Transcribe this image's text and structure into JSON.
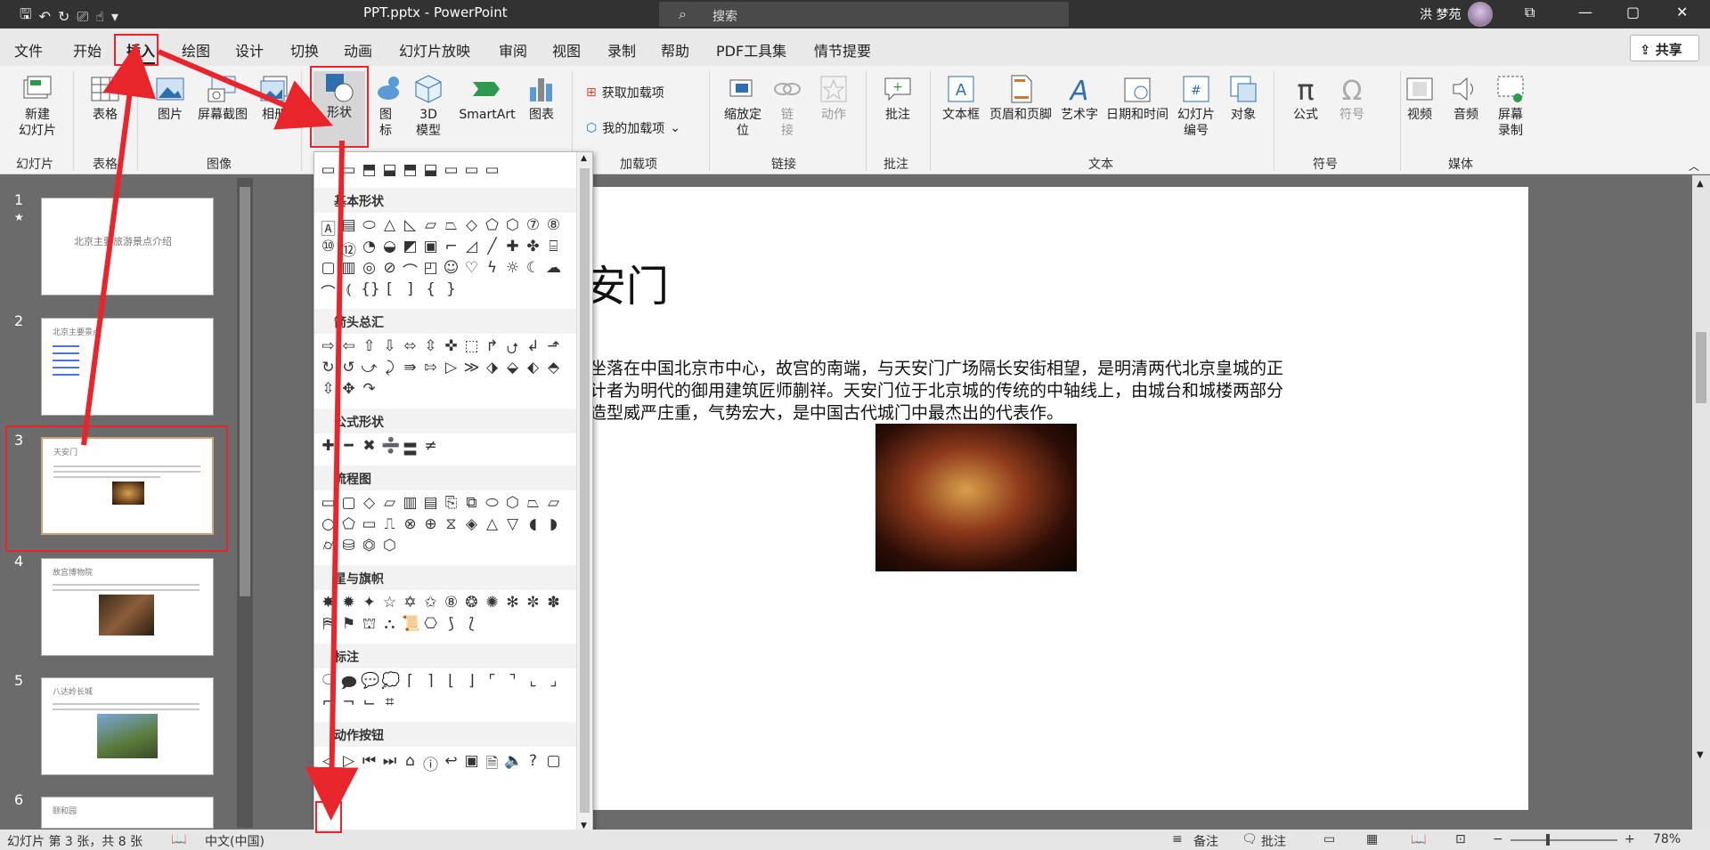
{
  "window": {
    "title": "PPT.pptx - PowerPoint",
    "search_placeholder": "搜索",
    "user_name": "洪 梦苑"
  },
  "menu": {
    "tabs": [
      "文件",
      "开始",
      "插入",
      "绘图",
      "设计",
      "切换",
      "动画",
      "幻灯片放映",
      "审阅",
      "视图",
      "录制",
      "帮助",
      "PDF工具集",
      "情节提要"
    ],
    "active": "插入",
    "share_label": "共享"
  },
  "ribbon": {
    "new_slide": "新建\n幻灯片",
    "table": "表格",
    "picture": "图片",
    "screenshot": "屏幕截图",
    "album": "相册",
    "shapes": "形状",
    "icons": "图\n标",
    "model3d": "3D\n模型",
    "smartart": "SmartArt",
    "chart": "图表",
    "get_addins": "获取加载项",
    "my_addins": "我的加载项",
    "zoom": "缩放定\n位",
    "link": "链\n接",
    "action": "动作",
    "comment": "批注",
    "textbox": "文本框",
    "header_footer": "页眉和页脚",
    "wordart": "艺术字",
    "datetime": "日期和时间",
    "slide_number": "幻灯片\n编号",
    "object": "对象",
    "equation": "公式",
    "symbol": "符号",
    "video": "视频",
    "audio": "音频",
    "screen_record": "屏幕\n录制",
    "groups": {
      "slides": "幻灯片",
      "tables": "表格",
      "images": "图像",
      "addins": "加载项",
      "links": "链接",
      "comments": "批注",
      "text": "文本",
      "symbols": "符号",
      "media": "媒体"
    }
  },
  "thumbnails": [
    {
      "num": "1",
      "star": "★",
      "title": "北京主要旅游景点介绍"
    },
    {
      "num": "2",
      "title": "北京主要景点"
    },
    {
      "num": "3",
      "title": "天安门"
    },
    {
      "num": "4",
      "title": "故宫博物院"
    },
    {
      "num": "5",
      "title": "八达岭长城"
    },
    {
      "num": "6",
      "title": "颐和园"
    }
  ],
  "slide": {
    "title": "安门",
    "body_line1": "坐落在中国北京市中心，故宫的南端，与天安门广场隔长安街相望，是明清两代北京皇城的正",
    "body_line2": "计者为明代的御用建筑匠师蒯祥。天安门位于北京城的传统的中轴线上，由城台和城楼两部分",
    "body_line3": "造型威严庄重，气势宏大，是中国古代城门中最杰出的代表作。"
  },
  "dropdown": {
    "sections": [
      "基本形状",
      "箭头总汇",
      "公式形状",
      "流程图",
      "星与旗帜",
      "标注",
      "动作按钮"
    ]
  },
  "status": {
    "slide_info": "幻灯片 第 3 张，共 8 张",
    "language": "中文(中国)",
    "notes": "备注",
    "comments": "批注",
    "zoom": "78%"
  }
}
